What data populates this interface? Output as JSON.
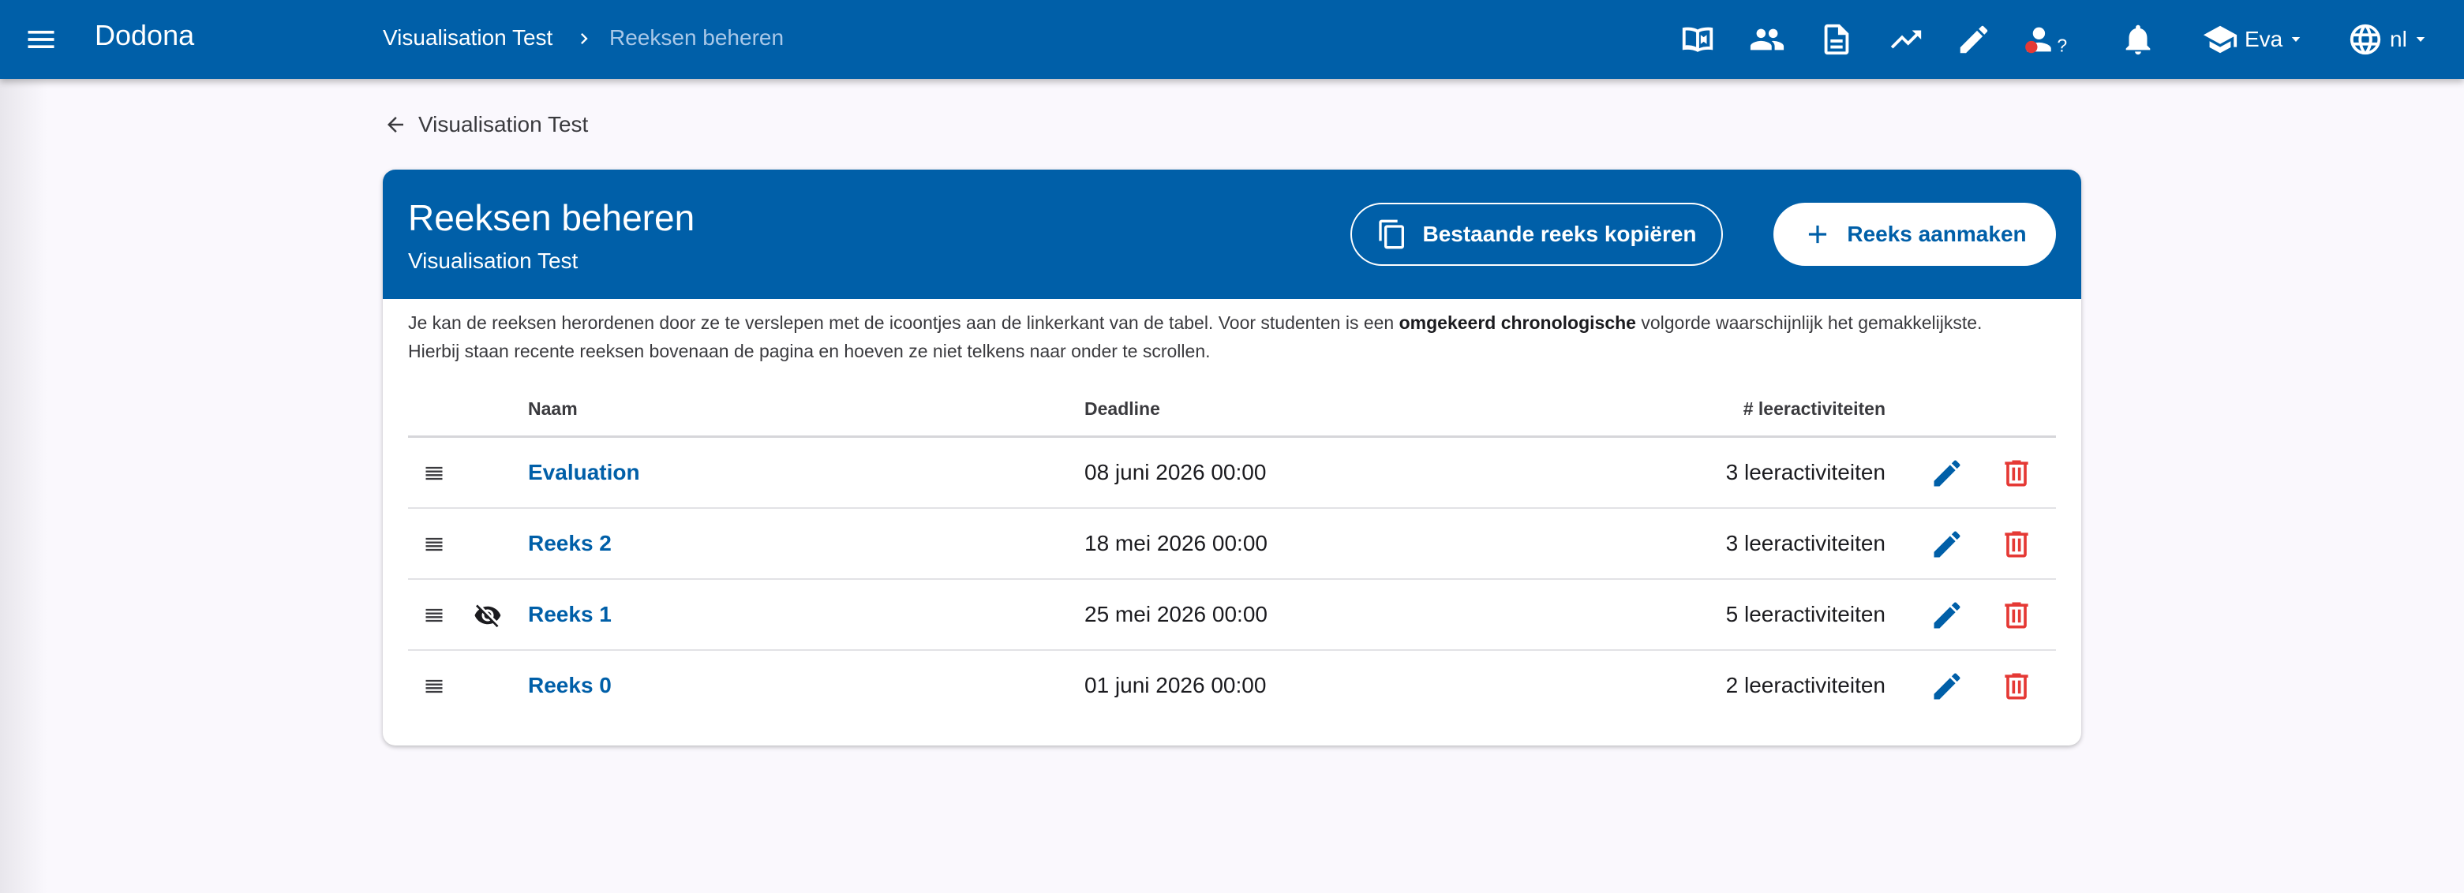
{
  "app": {
    "brand": "Dodona",
    "breadcrumb": {
      "course": "Visualisation Test",
      "current": "Reeksen beheren"
    },
    "nav_icons": [
      "library-book-icon",
      "users-icon",
      "document-icon",
      "trending-up-icon",
      "pencil-icon",
      "user-question-icon",
      "bell-icon"
    ],
    "user_name": "Eva",
    "language": "nl",
    "colors": {
      "primary": "#005fa8",
      "danger": "#e53935",
      "background": "#faf8fd"
    }
  },
  "back": {
    "label": "Visualisation Test"
  },
  "card": {
    "title": "Reeksen beheren",
    "subtitle": "Visualisation Test",
    "copy_button": "Bestaande reeks kopiëren",
    "create_button": "Reeks aanmaken",
    "intro_before": "Je kan de reeksen herordenen door ze te verslepen met de icoontjes aan de linkerkant van de tabel. Voor studenten is een ",
    "intro_bold": "omgekeerd chronologische",
    "intro_after": " volgorde waarschijnlijk het gemakkelijkste.",
    "intro_line2": "Hierbij staan recente reeksen bovenaan de pagina en hoeven ze niet telkens naar onder te scrollen."
  },
  "table": {
    "headers": {
      "name": "Naam",
      "deadline": "Deadline",
      "count": "# leeractiviteiten"
    },
    "rows": [
      {
        "name": "Evaluation",
        "deadline": "08 juni 2026 00:00",
        "count": "3 leeractiviteiten",
        "hidden": false
      },
      {
        "name": "Reeks 2",
        "deadline": "18 mei 2026 00:00",
        "count": "3 leeractiviteiten",
        "hidden": false
      },
      {
        "name": "Reeks 1",
        "deadline": "25 mei 2026 00:00",
        "count": "5 leeractiviteiten",
        "hidden": true
      },
      {
        "name": "Reeks 0",
        "deadline": "01 juni 2026 00:00",
        "count": "2 leeractiviteiten",
        "hidden": false
      }
    ]
  }
}
